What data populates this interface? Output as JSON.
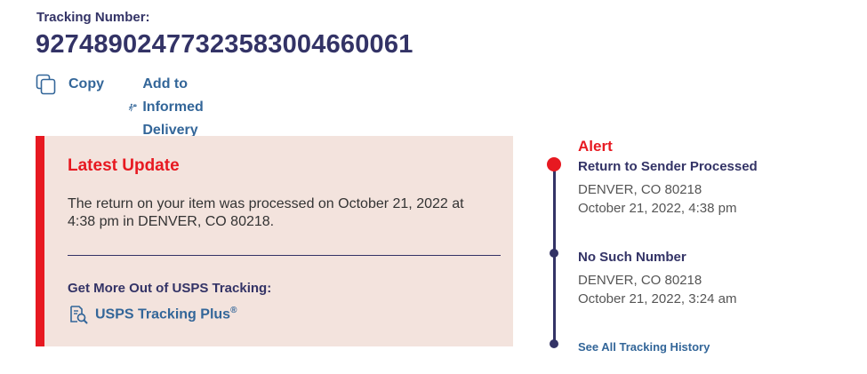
{
  "tracking": {
    "label": "Tracking Number:",
    "number": "9274890247732358300466006​1"
  },
  "actions": {
    "copy_label": "Copy",
    "informed_delivery_label": "Add to Informed Delivery"
  },
  "latest_update": {
    "title": "Latest Update",
    "text": "The return on your item was processed on October 21, 2022 at 4:38 pm in DENVER, CO 80218.",
    "more_title": "Get More Out of USPS Tracking:",
    "plus_link": "USPS Tracking Plus",
    "plus_mark": "®"
  },
  "timeline": {
    "alert_label": "Alert",
    "events": [
      {
        "status": "Return to Sender Processed",
        "location": "DENVER, CO 80218",
        "datetime": "October 21, 2022, 4:38 pm"
      },
      {
        "status": "No Such Number",
        "location": "DENVER, CO 80218",
        "datetime": "October 21, 2022, 3:24 am"
      }
    ],
    "see_all_label": "See All Tracking History"
  },
  "colors": {
    "alert_red": "#e71921",
    "navy": "#333366",
    "link_blue": "#336699",
    "card_bg": "#f3e3dd"
  },
  "icons": {
    "copy": "copy-icon",
    "informed_delivery": "mail-runner-icon",
    "tracking_plus": "document-search-icon"
  }
}
